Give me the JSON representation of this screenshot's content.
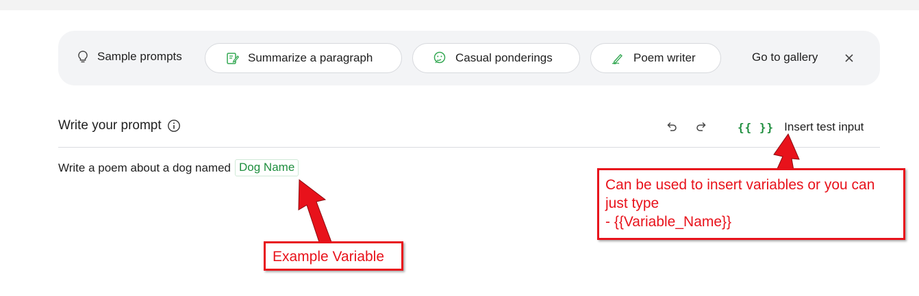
{
  "sample_prompts": {
    "label": "Sample prompts",
    "chips": [
      {
        "label": "Summarize a paragraph",
        "icon": "document-edit-icon"
      },
      {
        "label": "Casual ponderings",
        "icon": "thinking-face-icon"
      },
      {
        "label": "Poem writer",
        "icon": "pen-writing-icon"
      }
    ],
    "gallery_label": "Go to gallery"
  },
  "prompt": {
    "title": "Write your prompt",
    "insert_test_input_braces": "{{ }}",
    "insert_test_input_label": "Insert test input",
    "text": "Write a poem about a dog named",
    "variable": "Dog Name"
  },
  "annotations": {
    "insert_note_lines": [
      "Can be used to insert variables or you can",
      "just type",
      "- {{Variable_Name}}"
    ],
    "example_variable": "Example Variable"
  },
  "colors": {
    "accent_green": "#1e8e3e",
    "annotation_red": "#e8121b",
    "bar_background": "#f3f4f6"
  }
}
